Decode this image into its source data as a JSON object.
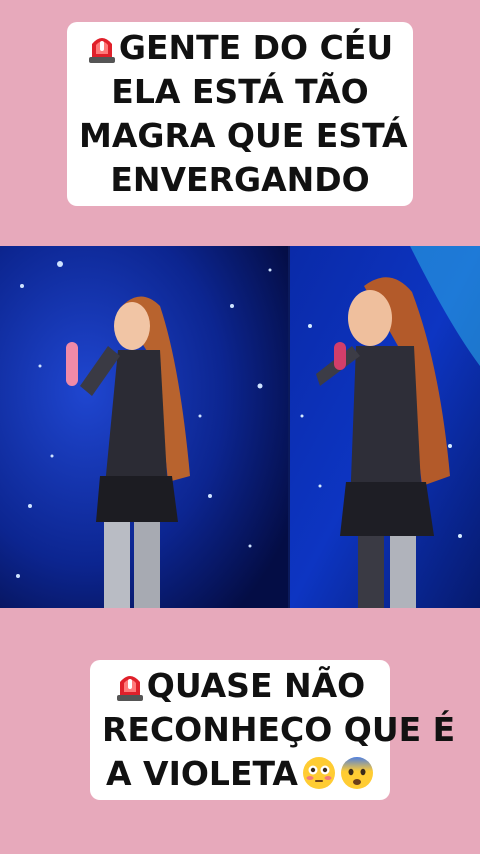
{
  "caption_top": {
    "line1": "GENTE DO CÉU",
    "line2": "ELA ESTÁ TÃO",
    "line3": "MAGRA QUE ESTÁ",
    "line4": "ENVERGANDO"
  },
  "caption_bottom": {
    "line1": "QUASE NÃO",
    "line2": "RECONHEÇO QUE É",
    "line3": "A VIOLETA"
  },
  "icons": {
    "siren": "police-siren-icon",
    "flushed": "flushed-face-icon",
    "fearful": "fearful-face-icon"
  },
  "colors": {
    "background": "#e7a9bb",
    "caption_bg": "#ffffff",
    "stage_blue": "#0a2a9a"
  }
}
